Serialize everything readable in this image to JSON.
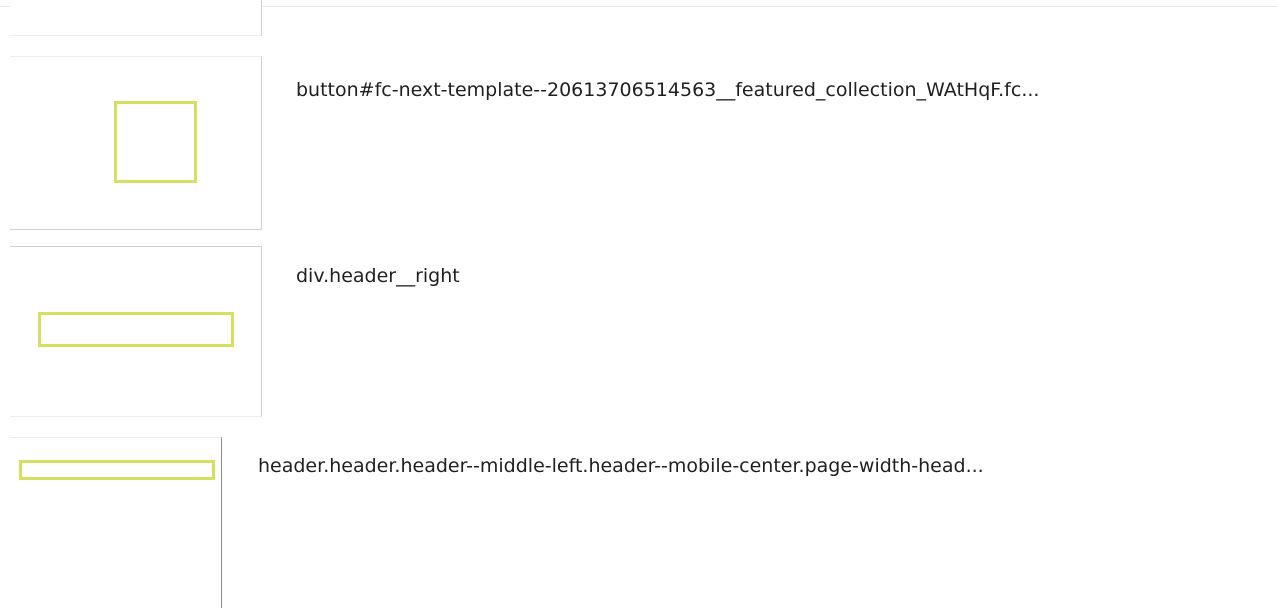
{
  "results": [
    {
      "label": ""
    },
    {
      "label": "button#fc-next-template--20613706514563__featured_collection_WAtHqF.fc..."
    },
    {
      "label": "div.header__right"
    },
    {
      "label": "header.header.header--middle-left.header--mobile-center.page-width-head..."
    }
  ],
  "colors": {
    "highlight": "#d5e060",
    "divider": "#d0d0d0",
    "text": "#1f1f1f"
  }
}
